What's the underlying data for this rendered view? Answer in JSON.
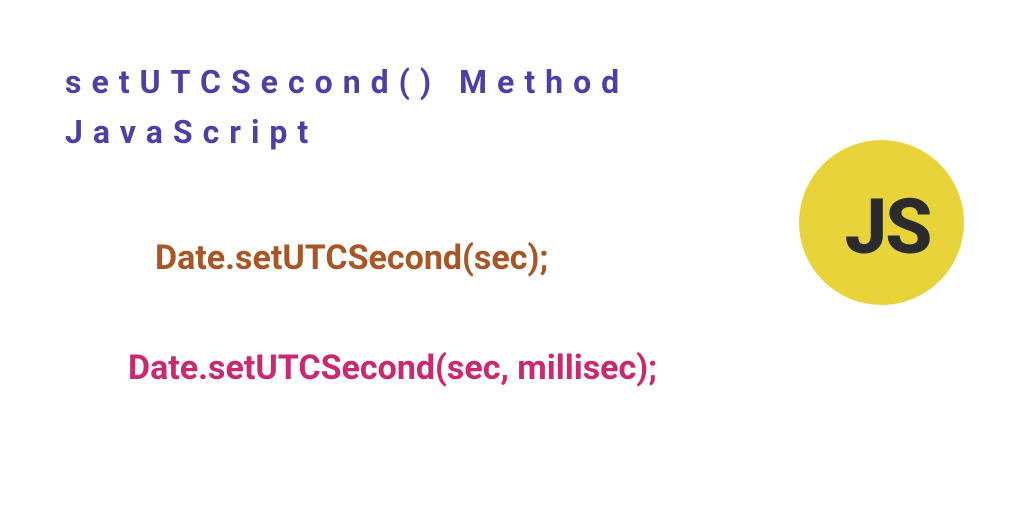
{
  "title": {
    "line1": "setUTCSecond() Method",
    "line2": "JavaScript"
  },
  "code": {
    "syntax1": "Date.setUTCSecond(sec);",
    "syntax2": "Date.setUTCSecond(sec, millisec);"
  },
  "badge": {
    "text": "JS"
  },
  "colors": {
    "title": "#4d3fa3",
    "syntax1": "#a85625",
    "syntax2": "#c92970",
    "badge_bg": "#e9d33a",
    "badge_text": "#2b2b2b"
  }
}
